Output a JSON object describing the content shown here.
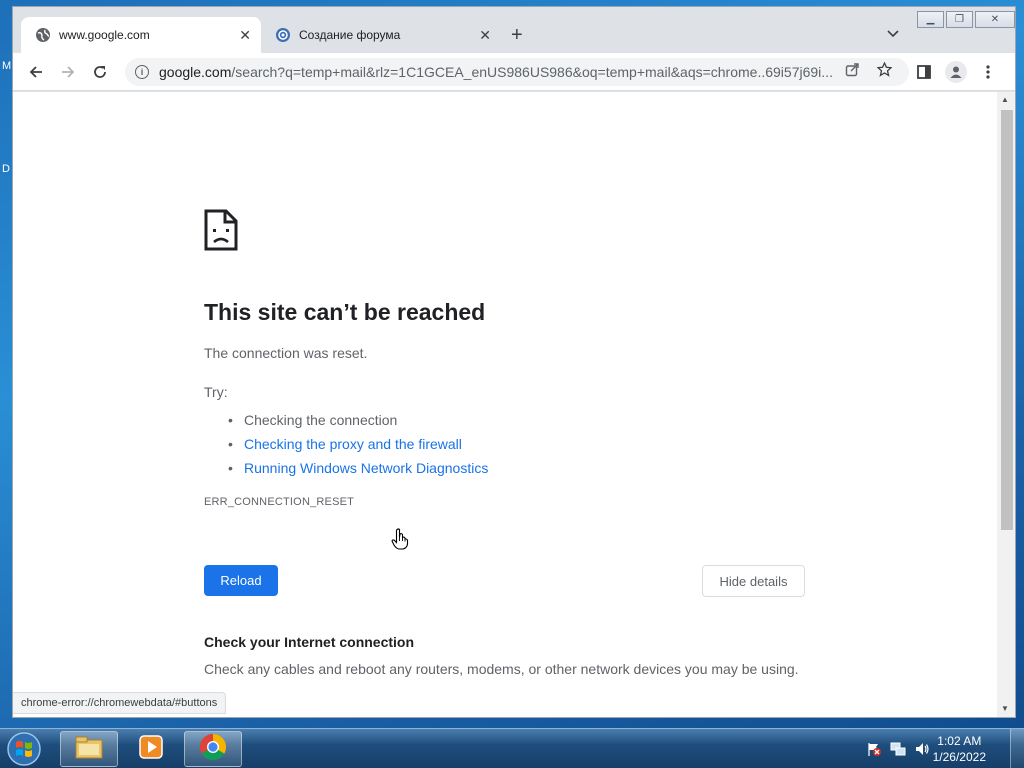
{
  "desktop": {
    "letters": [
      "M",
      "D"
    ]
  },
  "browser": {
    "tabs": [
      {
        "title": "www.google.com",
        "active": true
      },
      {
        "title": "Создание форума",
        "active": false
      }
    ],
    "omnibox": {
      "host": "google.com",
      "path": "/search?q=temp+mail&rlz=1C1GCEA_enUS986US986&oq=temp+mail&aqs=chrome..69i57j69i..."
    }
  },
  "error_page": {
    "title": "This site can’t be reached",
    "subtitle": "The connection was reset.",
    "try_label": "Try:",
    "suggestions": [
      {
        "text": "Checking the connection",
        "is_link": false
      },
      {
        "text": "Checking the proxy and the firewall",
        "is_link": true
      },
      {
        "text": "Running Windows Network Diagnostics",
        "is_link": true
      }
    ],
    "error_code": "ERR_CONNECTION_RESET",
    "reload_label": "Reload",
    "details_label": "Hide details",
    "check_title": "Check your Internet connection",
    "check_body": "Check any cables and reboot any routers, modems, or other network devices you may be using."
  },
  "status_bar": {
    "url": "chrome-error://chromewebdata/#buttons"
  },
  "taskbar": {
    "time": "1:02 AM",
    "date": "1/26/2022"
  },
  "colors": {
    "link": "#1a73e8",
    "primary_button": "#1a73e8"
  }
}
